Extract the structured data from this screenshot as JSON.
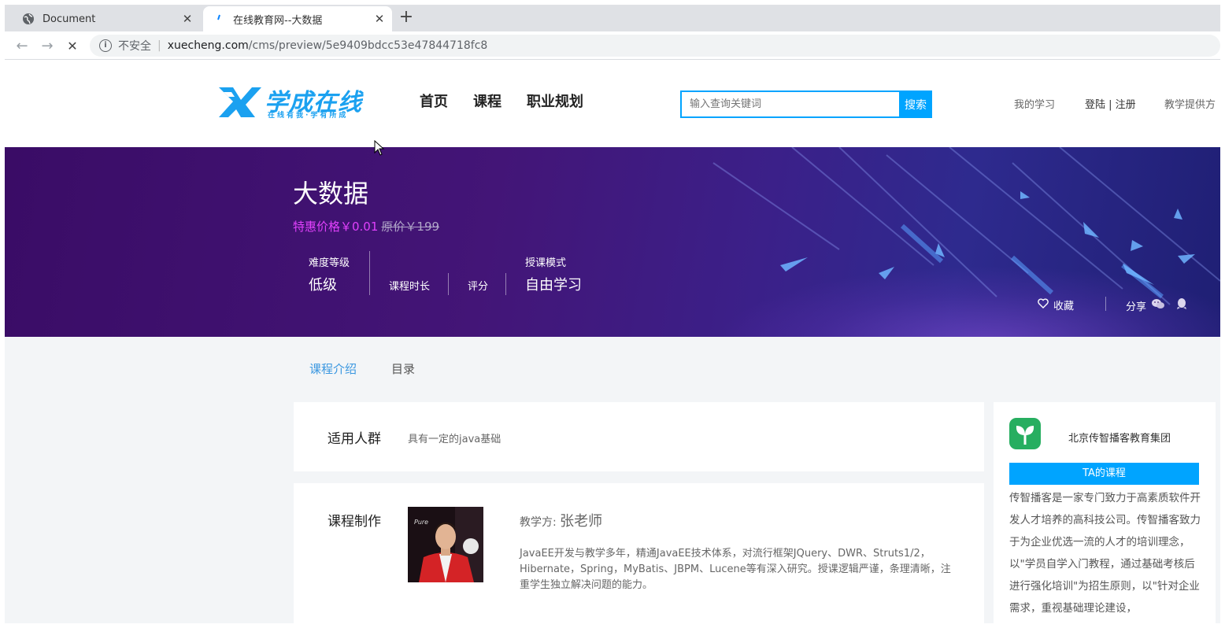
{
  "browser": {
    "tabs": [
      {
        "title": "Document",
        "icon": "globe-icon"
      },
      {
        "title": "在线教育网--大数据",
        "icon": "site-favicon"
      }
    ],
    "address": {
      "security_label": "不安全",
      "url_host": "xuecheng.com",
      "url_path": "/cms/preview/5e9409bdcc53e47844718fc8"
    }
  },
  "header": {
    "logo_text": "学成在线",
    "logo_slogan": "在线有我·学有所成",
    "nav": [
      "首页",
      "课程",
      "职业规划"
    ],
    "search": {
      "placeholder": "输入查询关键词",
      "button": "搜索"
    },
    "links": {
      "my_learning": "我的学习",
      "login_register": "登陆 | 注册",
      "provider": "教学提供方"
    }
  },
  "course": {
    "title": "大数据",
    "price_now": "特惠价格￥0.01",
    "price_orig": "原价￥199",
    "difficulty_label": "难度等级",
    "difficulty_value": "低级",
    "duration_label": "课程时长",
    "rating_label": "评分",
    "mode_label": "授课模式",
    "mode_value": "自由学习",
    "favorite": "收藏",
    "share": "分享"
  },
  "content_tabs": [
    "课程介绍",
    "目录"
  ],
  "audience": {
    "label": "适用人群",
    "text": "具有一定的java基础"
  },
  "production": {
    "label": "课程制作",
    "teacher_prefix": "教学方:",
    "teacher_name": "张老师",
    "desc": "JavaEE开发与教学多年，精通JavaEE技术体系，对流行框架JQuery、DWR、Struts1/2，Hibernate，Spring，MyBatis、JBPM、Lucene等有深入研究。授课逻辑严谨，条理清晰，注重学生独立解决问题的能力。"
  },
  "organization": {
    "name": "北京传智播客教育集团",
    "button": "TA的课程",
    "desc": "传智播客是一家专门致力于高素质软件开发人才培养的高科技公司。传智播客致力于为企业优选一流的人才的培训理念，以\"学员自学入门教程，通过基础考核后进行强化培训\"为招生原则，以\"针对企业需求，重视基础理论建设，"
  },
  "colors": {
    "accent": "#00a4ff",
    "banner": "#431577",
    "price": "#e040fb",
    "tab_active": "#3a97e0"
  }
}
